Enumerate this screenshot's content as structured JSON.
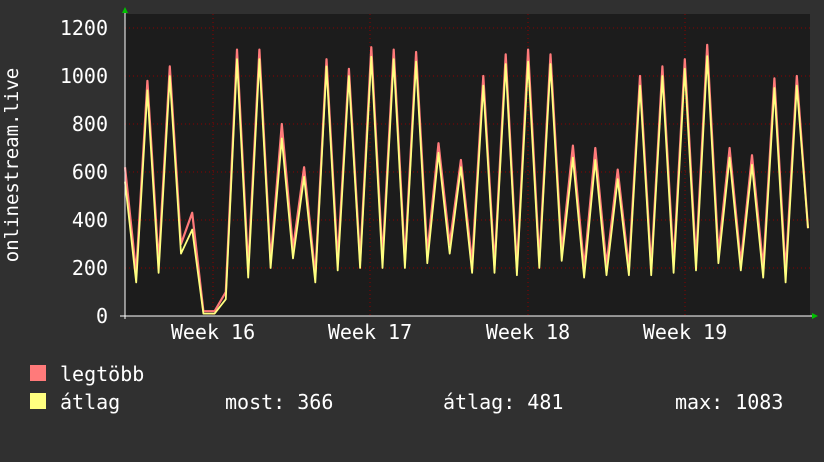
{
  "chart_data": {
    "type": "area",
    "ylabel": "onlinestream.live",
    "ylim": [
      0,
      1200
    ],
    "yticks": [
      0,
      200,
      400,
      600,
      800,
      1000,
      1200
    ],
    "x_tick_labels": [
      "Week 16",
      "Week 17",
      "Week 18",
      "Week 19"
    ],
    "grid": true,
    "series": [
      {
        "name": "legtöbb",
        "color": "#ff7a7a",
        "values": [
          620,
          180,
          980,
          220,
          1040,
          300,
          430,
          20,
          20,
          100,
          1110,
          200,
          1110,
          230,
          800,
          280,
          620,
          170,
          1070,
          230,
          1030,
          230,
          1120,
          240,
          1110,
          230,
          1100,
          260,
          720,
          300,
          650,
          220,
          1000,
          210,
          1090,
          200,
          1110,
          230,
          1090,
          270,
          710,
          200,
          700,
          210,
          610,
          200,
          1000,
          200,
          1040,
          220,
          1070,
          230,
          1130,
          260,
          700,
          220,
          670,
          200,
          990,
          180,
          1000,
          366
        ]
      },
      {
        "name": "átlag",
        "color": "#ffff80",
        "values": [
          560,
          140,
          940,
          180,
          1000,
          260,
          360,
          10,
          10,
          70,
          1070,
          160,
          1070,
          200,
          740,
          240,
          580,
          140,
          1040,
          190,
          1000,
          200,
          1080,
          200,
          1070,
          200,
          1060,
          220,
          680,
          260,
          620,
          180,
          960,
          180,
          1050,
          170,
          1060,
          200,
          1050,
          230,
          660,
          160,
          650,
          170,
          570,
          170,
          960,
          170,
          1000,
          180,
          1030,
          190,
          1083,
          220,
          660,
          190,
          630,
          160,
          950,
          140,
          960,
          366
        ]
      }
    ],
    "stats": {
      "most_label": "most: 366",
      "atlag_label": "átlag: 481",
      "max_label": "max: 1083"
    }
  },
  "colors": {
    "background": "#303030",
    "plot_bg": "#1c1c1c",
    "grid": "#8b0000",
    "axis": "#ffffff",
    "arrow": "#00c000"
  }
}
